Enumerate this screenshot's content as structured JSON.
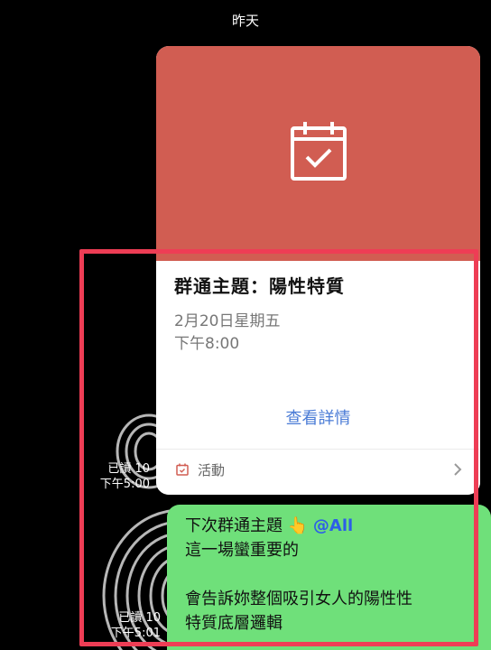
{
  "date_header": "昨天",
  "event_card": {
    "title": "群通主題：陽性特質",
    "date": "2月20日星期五",
    "time": "下午8:00",
    "details_link": "查看詳情",
    "footer_label": "活動",
    "banner_color": "#d15d52",
    "link_color": "#4a7bd6"
  },
  "receipts": [
    {
      "read": "已讀 10",
      "time": "下午5:00"
    },
    {
      "read": "已讀 10",
      "time": "下午5:01"
    }
  ],
  "message": {
    "line1_text": "下次群通主題",
    "line1_emoji": "👆",
    "mention": "@All",
    "line2": "這一場蠻重要的",
    "line4": "會告訴妳整個吸引女人的陽性性",
    "line5": "特質底層邏輯",
    "bubble_color": "#6fe07a"
  },
  "highlight_color": "#ee3d55"
}
